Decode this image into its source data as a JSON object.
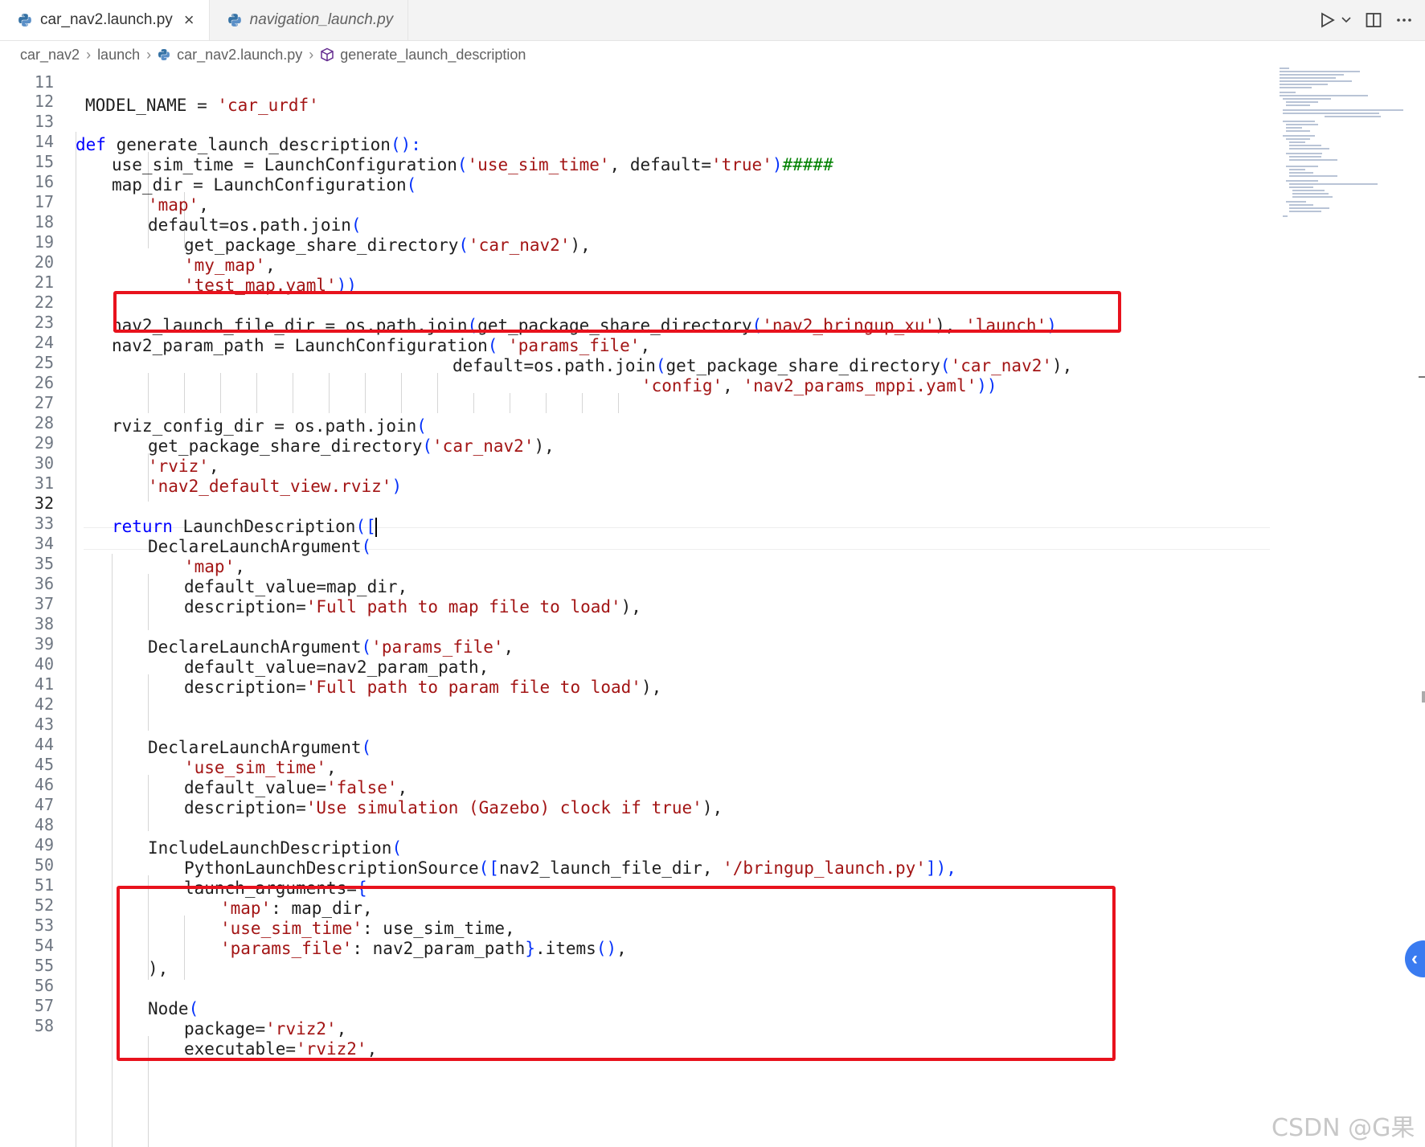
{
  "tabs": [
    {
      "label": "car_nav2.launch.py",
      "active": true,
      "icon": "python-icon"
    },
    {
      "label": "navigation_launch.py",
      "active": false,
      "icon": "python-icon"
    }
  ],
  "tab_actions": [
    "run-icon",
    "chevron-down-icon",
    "split-editor-icon",
    "more-icon"
  ],
  "breadcrumb": {
    "items": [
      "car_nav2",
      "launch",
      "car_nav2.launch.py",
      "generate_launch_description"
    ]
  },
  "editor": {
    "current_line": "32",
    "line_numbers": [
      "11",
      "12",
      "13",
      "14",
      "15",
      "16",
      "17",
      "18",
      "19",
      "20",
      "21",
      "22",
      "23",
      "24",
      "25",
      "26",
      "27",
      "28",
      "29",
      "30",
      "31",
      "32",
      "33",
      "34",
      "35",
      "36",
      "37",
      "38",
      "39",
      "40",
      "41",
      "42",
      "43",
      "44",
      "45",
      "46",
      "47",
      "48",
      "49",
      "50",
      "51",
      "52",
      "53",
      "54",
      "55",
      "56",
      "57",
      "58"
    ],
    "code": {
      "l11a": "MODEL_NAME",
      "l11b": " = ",
      "l11c": "'car_urdf'",
      "l13_kw": "def",
      "l13_rest": " generate_launch_description",
      "l13_p": "():",
      "l14a": "use_sim_time = LaunchConfiguration",
      "l14b": "(",
      "l14c": "'use_sim_time'",
      "l14d": ", default=",
      "l14e": "'true'",
      "l14f": ")",
      "l14g": "#####",
      "l15a": "map_dir = LaunchConfiguration",
      "l15b": "(",
      "l16a": "'map'",
      "l16b": ",",
      "l17a": "default=os.path.join",
      "l17b": "(",
      "l18a": "get_package_share_directory",
      "l18b": "(",
      "l18c": "'car_nav2'",
      "l18d": "),",
      "l19a": "'my_map'",
      "l19b": ",",
      "l20a": "'test_map.yaml'",
      "l20b": "))",
      "l22a": "nav2_launch_file_dir = os.path.join",
      "l22b": "(",
      "l22c": "get_package_share_directory",
      "l22d": "(",
      "l22e": "'nav2_bringup_xu'",
      "l22f": "), ",
      "l22g": "'launch'",
      "l22h": ")",
      "l23a": "nav2_param_path = LaunchConfiguration",
      "l23b": "( ",
      "l23c": "'params_file'",
      "l23d": ",",
      "l24a": "default=os.path.join",
      "l24b": "(",
      "l24c": "get_package_share_directory",
      "l24d": "(",
      "l24e": "'car_nav2'",
      "l24f": "),",
      "l25a": "'config'",
      "l25b": ", ",
      "l25c": "'nav2_params_mppi.yaml'",
      "l25d": "))",
      "l27a": "rviz_config_dir = os.path.join",
      "l27b": "(",
      "l28a": "get_package_share_directory",
      "l28b": "(",
      "l28c": "'car_nav2'",
      "l28d": "),",
      "l29a": "'rviz'",
      "l29b": ",",
      "l30a": "'nav2_default_view.rviz'",
      "l30b": ")",
      "l32_kw": "return",
      "l32a": " LaunchDescription",
      "l32b": "([",
      "l33a": "DeclareLaunchArgument",
      "l33b": "(",
      "l34a": "'map'",
      "l34b": ",",
      "l35a": "default_value=map_dir,",
      "l36a": "description=",
      "l36b": "'Full path to map file to load'",
      "l36c": "),",
      "l38a": "DeclareLaunchArgument",
      "l38b": "(",
      "l38c": "'params_file'",
      "l38d": ",",
      "l39a": "default_value=nav2_param_path,",
      "l40a": "description=",
      "l40b": "'Full path to param file to load'",
      "l40c": "),",
      "l43a": "DeclareLaunchArgument",
      "l43b": "(",
      "l44a": "'use_sim_time'",
      "l44b": ",",
      "l45a": "default_value=",
      "l45b": "'false'",
      "l45c": ",",
      "l46a": "description=",
      "l46b": "'Use simulation (Gazebo) clock if true'",
      "l46c": "),",
      "l48a": "IncludeLaunchDescription",
      "l48b": "(",
      "l49a": "PythonLaunchDescriptionSource",
      "l49b": "([",
      "l49c": "nav2_launch_file_dir, ",
      "l49d": "'/bringup_launch.py'",
      "l49e": "]),",
      "l50a": "launch_arguments=",
      "l50b": "{",
      "l51a": "'map'",
      "l51b": ": map_dir,",
      "l52a": "'use_sim_time'",
      "l52b": ": use_sim_time,",
      "l53a": "'params_file'",
      "l53b": ": nav2_param_path",
      "l53c": "}",
      "l53d": ".items",
      "l53e": "()",
      "l53f": ",",
      "l54a": "),",
      "l56a": "Node",
      "l56b": "(",
      "l57a": "package=",
      "l57b": "'rviz2'",
      "l57c": ",",
      "l58a": "executable=",
      "l58b": "'rviz2'",
      "l58c": ","
    }
  },
  "watermark": "CSDN @G果",
  "colors": {
    "keyword": "#0000ff",
    "string": "#a31515",
    "comment": "#008000",
    "bracket": "#0431fa",
    "highlight_box": "#e8121d"
  }
}
